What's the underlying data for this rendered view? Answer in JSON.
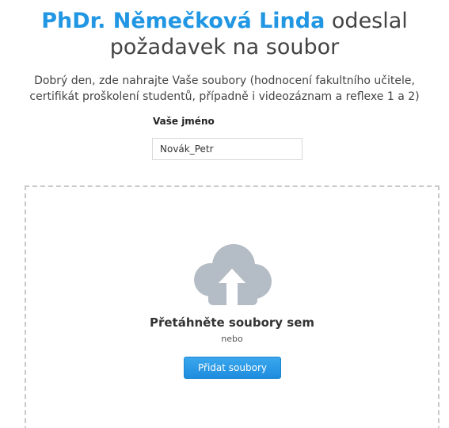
{
  "header": {
    "sender_name": "PhDr. Němečková Linda",
    "title_rest_line1": " odeslal",
    "title_line2": "požadavek na soubor"
  },
  "description": {
    "line1": "Dobrý den, zde nahrajte Vaše soubory (hodnocení fakultního učitele,",
    "line2": "certifikát proškolení studentů, případně i videozáznam a reflexe 1 a 2)"
  },
  "form": {
    "name_label": "Vaše jméno",
    "name_value": "Novák_Petr"
  },
  "dropzone": {
    "icon": "cloud-upload-icon",
    "drop_text": "Přetáhněte soubory sem",
    "or_text": "nebo",
    "button_label": "Přidat soubory"
  },
  "colors": {
    "accent": "#2196e3",
    "button": "#2a96e6",
    "cloud": "#b4bcc5",
    "border": "#c8c8c8"
  }
}
